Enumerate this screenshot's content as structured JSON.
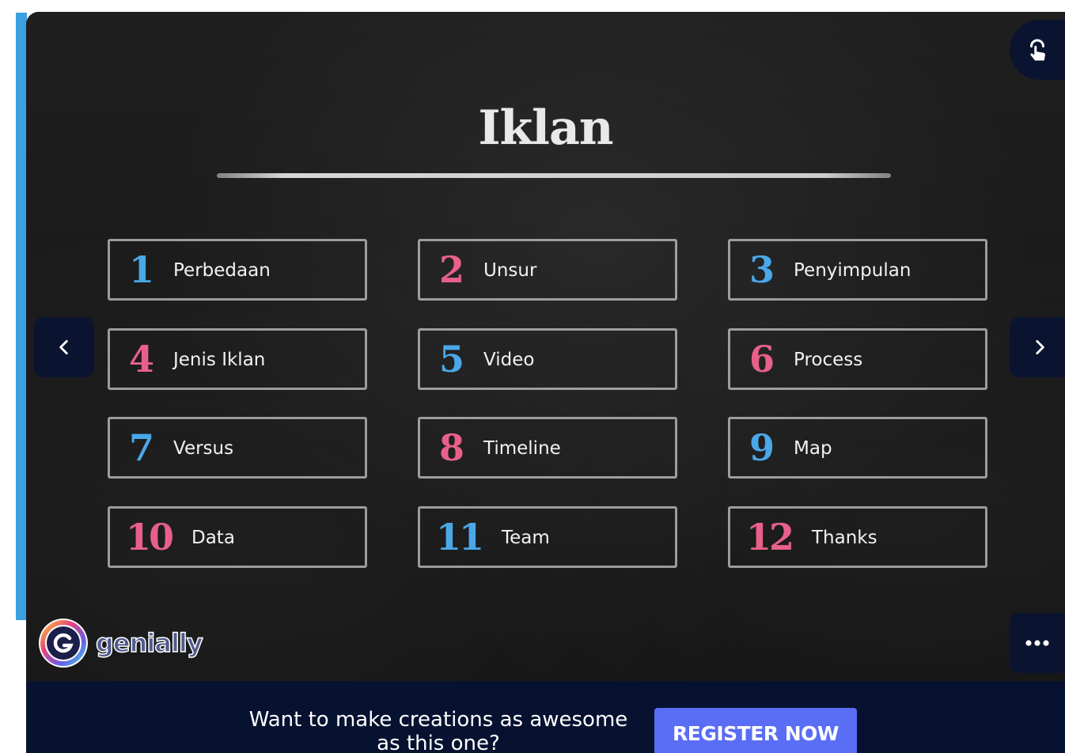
{
  "presentation": {
    "title": "Iklan",
    "items": [
      {
        "number": "1",
        "label": "Perbedaan",
        "color": "#4aa8e8"
      },
      {
        "number": "2",
        "label": "Unsur",
        "color": "#e8608a"
      },
      {
        "number": "3",
        "label": "Penyimpulan",
        "color": "#4aa8e8"
      },
      {
        "number": "4",
        "label": "Jenis Iklan",
        "color": "#e8608a"
      },
      {
        "number": "5",
        "label": "Video",
        "color": "#4aa8e8"
      },
      {
        "number": "6",
        "label": "Process",
        "color": "#e8608a"
      },
      {
        "number": "7",
        "label": "Versus",
        "color": "#4aa8e8"
      },
      {
        "number": "8",
        "label": "Timeline",
        "color": "#e8608a"
      },
      {
        "number": "9",
        "label": "Map",
        "color": "#4aa8e8"
      },
      {
        "number": "10",
        "label": "Data",
        "color": "#e8608a"
      },
      {
        "number": "11",
        "label": "Team",
        "color": "#4aa8e8"
      },
      {
        "number": "12",
        "label": "Thanks",
        "color": "#e8608a"
      }
    ]
  },
  "brand": {
    "logo_text": "genially"
  },
  "icons": {
    "prev": "chevron-left-icon",
    "next": "chevron-right-icon",
    "interact": "hand-pointer-icon",
    "more": "more-dots-icon",
    "logo": "genially-logo-icon"
  },
  "footer": {
    "promo_text": "Want to make creations as awesome as this one?",
    "register_label": "REGISTER NOW"
  },
  "colors": {
    "board": "#1c1c1c",
    "footer": "#061230",
    "button": "#5a6df5",
    "control": "#0a1430"
  }
}
